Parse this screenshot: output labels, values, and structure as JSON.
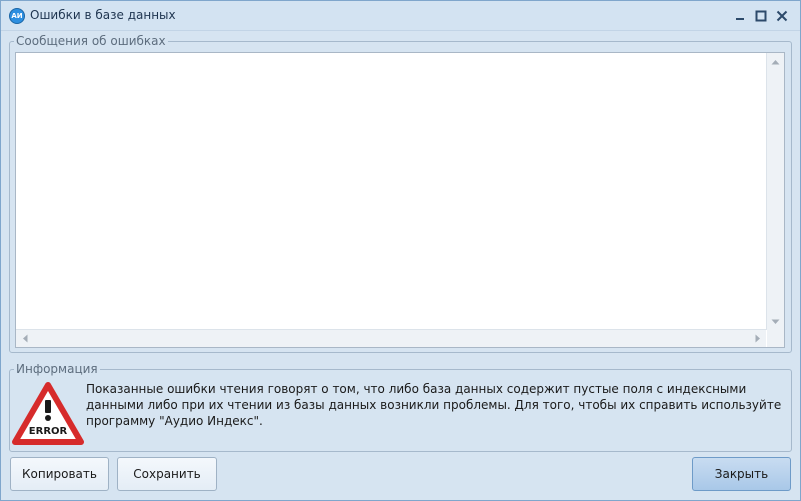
{
  "window": {
    "title": "Ошибки в базе данных",
    "app_icon_text": "АИ",
    "controls": [
      "minimize-icon",
      "maximize-icon",
      "close-icon"
    ]
  },
  "errors_group": {
    "label": "Сообщения об ошибках",
    "content": ""
  },
  "info_group": {
    "label": "Информация",
    "icon": "error-warning-icon",
    "icon_text": "ERROR",
    "message": "Показанные ошибки чтения говорят о том, что либо база данных содержит пустые поля с индексными данными либо при их чтении из базы данных возникли проблемы. Для того, чтобы их справить используйте программу \"Аудио Индекс\"."
  },
  "buttons": {
    "copy": "Копировать",
    "save": "Сохранить",
    "close": "Закрыть"
  },
  "colors": {
    "window_bg": "#d6e4f1",
    "accent": "#2d8fe0",
    "error_red": "#d62b2b"
  }
}
